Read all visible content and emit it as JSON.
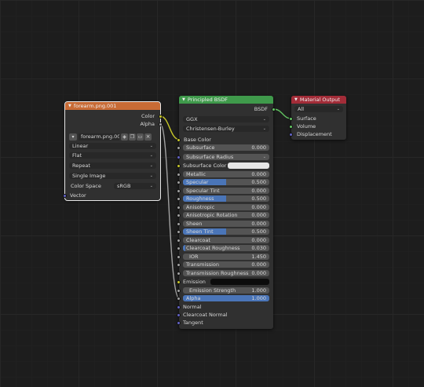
{
  "image_node": {
    "title": "forearm.png.001",
    "outputs": [
      "Color",
      "Alpha"
    ],
    "image_name": "forearm.png.001",
    "interpolation": "Linear",
    "projection": "Flat",
    "extension": "Repeat",
    "source": "Single Image",
    "color_space_label": "Color Space",
    "color_space_value": "sRGB",
    "input_vector": "Vector",
    "header_color": "#c86b35"
  },
  "bsdf_node": {
    "title": "Principled BSDF",
    "output": "BSDF",
    "distribution": "GGX",
    "subsurface_method": "Christensen-Burley",
    "base_color_label": "Base Color",
    "subsurface": {
      "label": "Subsurface",
      "value": "0.000",
      "fill": 0
    },
    "subsurface_radius": "Subsurface Radius",
    "subsurface_color": "Subsurface Color",
    "metallic": {
      "label": "Metallic",
      "value": "0.000",
      "fill": 0
    },
    "specular": {
      "label": "Specular",
      "value": "0.500",
      "fill": 0.5
    },
    "specular_tint": {
      "label": "Specular Tint",
      "value": "0.000",
      "fill": 0
    },
    "roughness": {
      "label": "Roughness",
      "value": "0.500",
      "fill": 0.5
    },
    "anisotropic": {
      "label": "Anisotropic",
      "value": "0.000",
      "fill": 0
    },
    "anisotropic_rotation": {
      "label": "Anisotropic Rotation",
      "value": "0.000",
      "fill": 0
    },
    "sheen": {
      "label": "Sheen",
      "value": "0.000",
      "fill": 0
    },
    "sheen_tint": {
      "label": "Sheen Tint",
      "value": "0.500",
      "fill": 0.5
    },
    "clearcoat": {
      "label": "Clearcoat",
      "value": "0.000",
      "fill": 0
    },
    "clearcoat_roughness": {
      "label": "Clearcoat Roughness",
      "value": "0.030",
      "fill": 0.03
    },
    "ior": {
      "label": "IOR",
      "value": "1.450"
    },
    "transmission": {
      "label": "Transmission",
      "value": "0.000",
      "fill": 0
    },
    "transmission_roughness": {
      "label": "Transmission Roughness",
      "value": "0.000",
      "fill": 0
    },
    "emission": "Emission",
    "emission_strength": {
      "label": "Emission Strength",
      "value": "1.000"
    },
    "alpha": {
      "label": "Alpha",
      "value": "1.000",
      "fill": 1
    },
    "normal": "Normal",
    "clearcoat_normal": "Clearcoat Normal",
    "tangent": "Tangent",
    "header_color": "#3f9a4b"
  },
  "output_node": {
    "title": "Material Output",
    "target": "All",
    "inputs": [
      "Surface",
      "Volume",
      "Displacement"
    ],
    "header_color": "#a22c38"
  }
}
